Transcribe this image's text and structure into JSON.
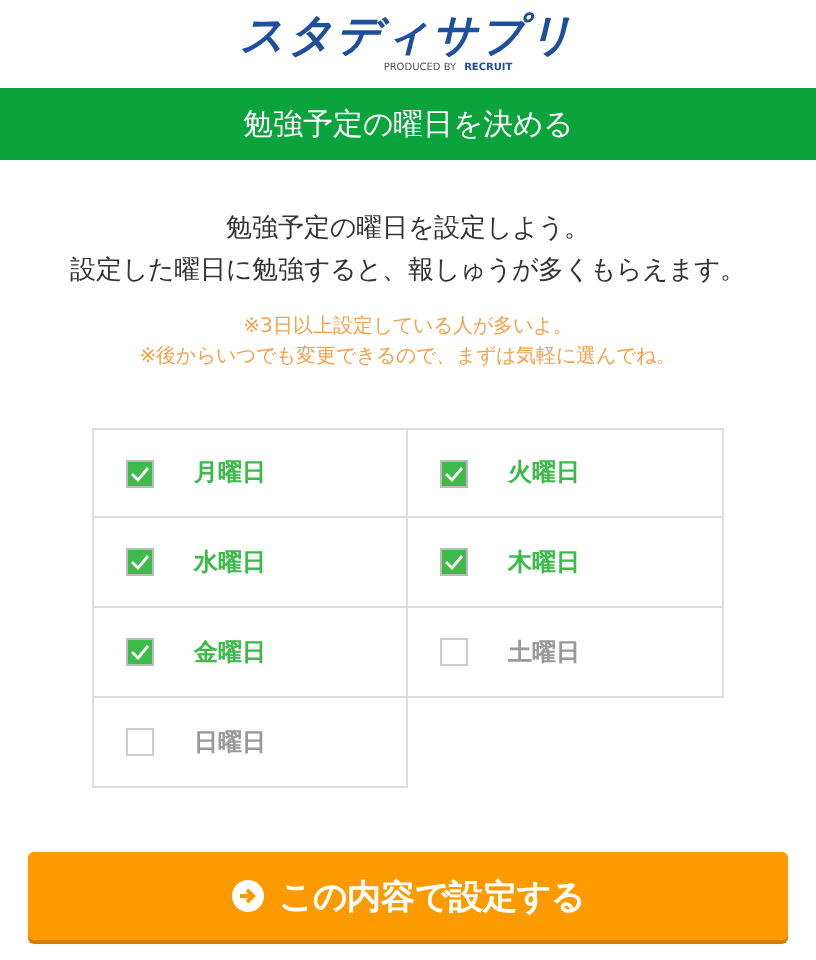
{
  "logo": {
    "name": "スタディサプリ",
    "byline": "PRODUCED BY",
    "company": "RECRUIT"
  },
  "header": {
    "title": "勉強予定の曜日を決める"
  },
  "intro": [
    "勉強予定の曜日を設定しよう。",
    "設定した曜日に勉強すると、報しゅうが多くもらえます。"
  ],
  "notes": [
    "※3日以上設定している人が多いよ。",
    "※後からいつでも変更できるので、まずは気軽に選んでね。"
  ],
  "days": [
    {
      "label": "月曜日",
      "checked": true
    },
    {
      "label": "火曜日",
      "checked": true
    },
    {
      "label": "水曜日",
      "checked": true
    },
    {
      "label": "木曜日",
      "checked": true
    },
    {
      "label": "金曜日",
      "checked": true
    },
    {
      "label": "土曜日",
      "checked": false
    },
    {
      "label": "日曜日",
      "checked": false
    }
  ],
  "submit": {
    "label": "この内容で設定する"
  }
}
